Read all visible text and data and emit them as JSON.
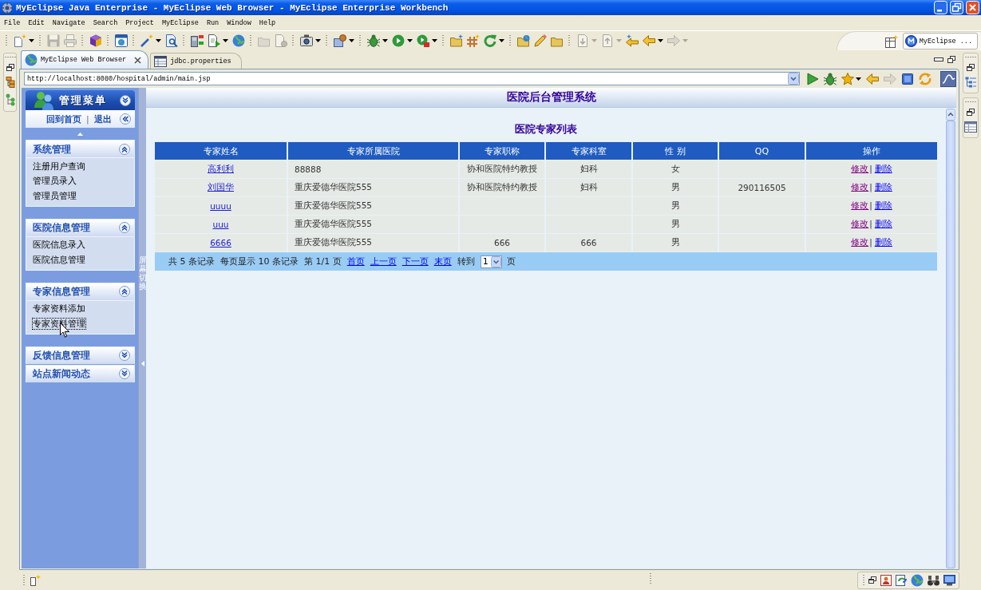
{
  "window": {
    "title": "MyEclipse Java Enterprise - MyEclipse Web Browser - MyEclipse Enterprise Workbench"
  },
  "menu_bar": [
    "File",
    "Edit",
    "Navigate",
    "Search",
    "Project",
    "MyEclipse",
    "Run",
    "Window",
    "Help"
  ],
  "toolbar": {
    "groups": [
      {
        "items": [
          {
            "kind": "new",
            "disabled": false,
            "dropdown": true
          }
        ]
      },
      {
        "items": [
          {
            "kind": "save",
            "disabled": true,
            "dropdown": false
          },
          {
            "kind": "print",
            "disabled": true,
            "dropdown": false
          }
        ]
      },
      {
        "items": [
          {
            "kind": "cube",
            "disabled": false,
            "dropdown": false
          }
        ]
      },
      {
        "items": [
          {
            "kind": "browser",
            "disabled": false,
            "dropdown": false
          }
        ]
      },
      {
        "items": [
          {
            "kind": "wand",
            "disabled": false,
            "dropdown": true
          },
          {
            "kind": "pagesearch",
            "disabled": false,
            "dropdown": false
          }
        ]
      },
      {
        "items": [
          {
            "kind": "server",
            "disabled": false,
            "dropdown": false
          },
          {
            "kind": "deploy",
            "disabled": false,
            "dropdown": true
          },
          {
            "kind": "globe",
            "disabled": false,
            "dropdown": false
          }
        ]
      },
      {
        "items": [
          {
            "kind": "open",
            "disabled": true,
            "dropdown": false
          },
          {
            "kind": "pagegear",
            "disabled": true,
            "dropdown": false
          }
        ]
      },
      {
        "items": [
          {
            "kind": "camera",
            "disabled": false,
            "dropdown": true
          }
        ]
      },
      {
        "items": [
          {
            "kind": "package",
            "disabled": false,
            "dropdown": true
          }
        ]
      },
      {
        "items": [
          {
            "kind": "bug",
            "disabled": false,
            "dropdown": true
          },
          {
            "kind": "run",
            "disabled": false,
            "dropdown": true
          },
          {
            "kind": "runtool",
            "disabled": false,
            "dropdown": true
          }
        ]
      },
      {
        "items": [
          {
            "kind": "newfolder",
            "disabled": false,
            "dropdown": false
          },
          {
            "kind": "grid",
            "disabled": false,
            "dropdown": false
          },
          {
            "kind": "refresh",
            "disabled": false,
            "dropdown": true
          }
        ]
      },
      {
        "items": [
          {
            "kind": "folderglobe",
            "disabled": false,
            "dropdown": false
          },
          {
            "kind": "pencil",
            "disabled": false,
            "dropdown": false
          },
          {
            "kind": "folder",
            "disabled": false,
            "dropdown": false
          }
        ]
      },
      {
        "items": [
          {
            "kind": "pagedown",
            "disabled": true,
            "dropdown": true
          },
          {
            "kind": "pageup",
            "disabled": true,
            "dropdown": true
          },
          {
            "kind": "backstar",
            "disabled": false,
            "dropdown": false
          },
          {
            "kind": "back",
            "disabled": false,
            "dropdown": true
          },
          {
            "kind": "forward",
            "disabled": true,
            "dropdown": true
          }
        ]
      }
    ],
    "perspective": "MyEclipse ..."
  },
  "editor_tabs": [
    {
      "label": "MyEclipse Web Browser",
      "kind": "browser",
      "selected": true
    },
    {
      "label": "jdbc.properties",
      "kind": "properties",
      "selected": false
    }
  ],
  "browser": {
    "url": "http://localhost:8080/hospital/admin/main.jsp",
    "tools": [
      {
        "kind": "go",
        "disabled": false,
        "dropdown": false
      },
      {
        "kind": "bug",
        "disabled": false,
        "dropdown": false
      },
      {
        "kind": "star",
        "disabled": false,
        "dropdown": true
      },
      {
        "kind": "back",
        "disabled": false,
        "dropdown": false
      },
      {
        "kind": "forward",
        "disabled": true,
        "dropdown": false
      },
      {
        "kind": "stop",
        "disabled": false,
        "dropdown": false
      },
      {
        "kind": "sync",
        "disabled": false,
        "dropdown": false
      }
    ]
  },
  "admin_menu": {
    "title": "管理菜单",
    "home_link": "回到首页",
    "divider": "|",
    "logout_link": "退出",
    "groups": [
      {
        "title": "系统管理",
        "expanded": true,
        "items": [
          {
            "label": "注册用户查询",
            "focused": false
          },
          {
            "label": "管理员录入",
            "focused": false
          },
          {
            "label": "管理员管理",
            "focused": false
          }
        ]
      },
      {
        "title": "医院信息管理",
        "expanded": true,
        "items": [
          {
            "label": "医院信息录入",
            "focused": false
          },
          {
            "label": "医院信息管理",
            "focused": false
          }
        ]
      },
      {
        "title": "专家信息管理",
        "expanded": true,
        "items": [
          {
            "label": "专家资料添加",
            "focused": false
          },
          {
            "label": "专家资料管理",
            "focused": true
          }
        ]
      },
      {
        "title": "反馈信息管理",
        "expanded": false
      },
      {
        "title": "站点新闻动态",
        "expanded": false
      }
    ]
  },
  "splitter": {
    "label": "屏幕切换"
  },
  "page": {
    "title": "医院后台管理系统"
  },
  "expert_table": {
    "title": "医院专家列表",
    "columns": [
      "专家姓名",
      "专家所属医院",
      "专家职称",
      "专家科室",
      "性 别",
      "QQ",
      "操作"
    ],
    "rows": [
      {
        "name": "高利利",
        "hospital": "88888",
        "title": "协和医院特约教授",
        "department": "妇科",
        "gender": "女",
        "separator": "|",
        "actions": [
          {
            "label": "修改",
            "visited": true
          },
          {
            "label": "删除",
            "visited": false
          }
        ]
      },
      {
        "name": "刘国华",
        "hospital": "重庆爱德华医院555",
        "title": "协和医院特约教授",
        "department": "妇科",
        "gender": "男",
        "qq": "290116505",
        "separator": "|",
        "actions": [
          {
            "label": "修改",
            "visited": true
          },
          {
            "label": "删除",
            "visited": false
          }
        ]
      },
      {
        "name": "uuuu",
        "hospital": "重庆爱德华医院555",
        "gender": "男",
        "separator": "|",
        "actions": [
          {
            "label": "修改",
            "visited": true
          },
          {
            "label": "删除",
            "visited": false
          }
        ]
      },
      {
        "name": "uuu",
        "hospital": "重庆爱德华医院555",
        "gender": "男",
        "separator": "|",
        "actions": [
          {
            "label": "修改",
            "visited": true
          },
          {
            "label": "删除",
            "visited": false
          }
        ]
      },
      {
        "name": "6666",
        "hospital": "重庆爱德华医院555",
        "title": "666",
        "department": "666",
        "gender": "男",
        "separator": "|",
        "actions": [
          {
            "label": "修改",
            "visited": true
          },
          {
            "label": "删除",
            "visited": false
          }
        ]
      }
    ],
    "pager": {
      "total": "共 5 条记录",
      "per_page": "每页显示 10 条记录",
      "page_info": "第 1/1 页",
      "links": [
        "首页",
        "上一页",
        "下一页",
        "末页"
      ],
      "goto_label": "转到",
      "page_select": "1",
      "page_suffix": "页"
    }
  }
}
